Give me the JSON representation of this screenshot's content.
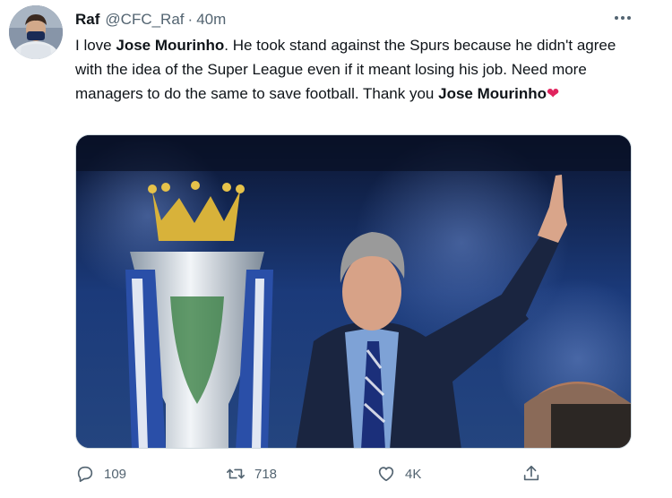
{
  "tweet": {
    "display_name": "Raf",
    "handle": "@CFC_Raf",
    "separator": "·",
    "time": "40m",
    "text_parts": [
      "I love ",
      "Jose Mourinho",
      ". He took stand against the Spurs because he didn't agree with the idea of the Super League even if it meant losing his job. Need more managers to do the same to save football. Thank you ",
      "Jose Mourinho"
    ],
    "heart_emoji": "❤"
  },
  "actions": {
    "reply_count": "109",
    "retweet_count": "718",
    "like_count": "4K"
  },
  "icons": {
    "more": "more-dots-icon",
    "reply": "reply-icon",
    "retweet": "retweet-icon",
    "like": "heart-icon",
    "share": "share-icon"
  },
  "colors": {
    "text_primary": "#0f1419",
    "text_secondary": "#536471",
    "heart": "#e0245e"
  }
}
